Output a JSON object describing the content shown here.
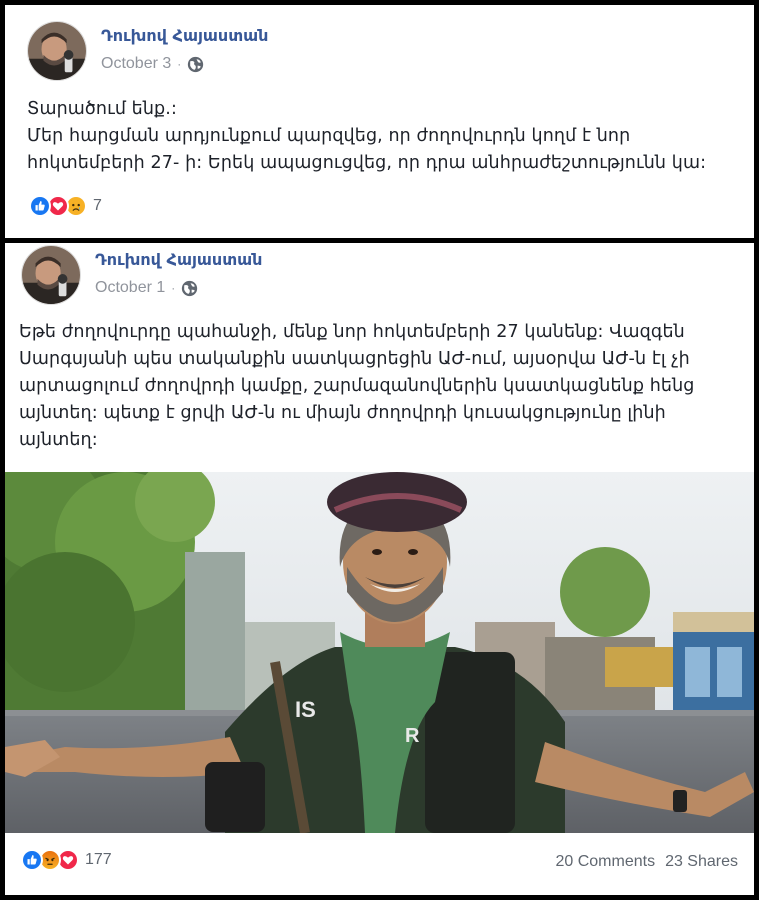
{
  "posts": [
    {
      "author": "Դուխով Հայաստան",
      "date": "October 3",
      "text_lines": [
        "Տարածում ենք.:",
        "Մեր հարցման արդյունքում պարզվեց, որ ժողովուրդն կողմ է նոր",
        "հոկտեմբերի 27- ի: Երեկ ապացուցվեց, որ դրա անհրաժեշտությունն կա:"
      ],
      "reaction_icons": [
        "like-icon",
        "love-icon",
        "sad-icon"
      ],
      "reaction_count": "7"
    },
    {
      "author": "Դուխով Հայաստան",
      "date": "October 1",
      "text_lines": [
        "Եթե ժողովուրդը պահանջի, մենք նոր հոկտեմբերի 27 կանենք: Վազգեն",
        "Սարգսյանի պես տականքին սատկացրեցին ԱԺ-ում, այսօրվա ԱԺ-ն էլ չի",
        "արտացոլում ժողովրդի կամքը, շարմազանովներին կսատկացնենք հենց",
        "այնտեղ: պետք է ցրվի ԱԺ-ն ու միայն ժողովրդի կուսակցությունը լինի",
        "այնտեղ:"
      ],
      "reaction_icons": [
        "like-icon",
        "angry-icon",
        "love-icon"
      ],
      "reaction_count": "177",
      "comments": "20 Comments",
      "shares": "23 Shares"
    }
  ],
  "colors": {
    "author": "#385898",
    "meta": "#90949c",
    "like": "#1877f2",
    "love": "#f0284a",
    "haha": "#f7b125"
  }
}
